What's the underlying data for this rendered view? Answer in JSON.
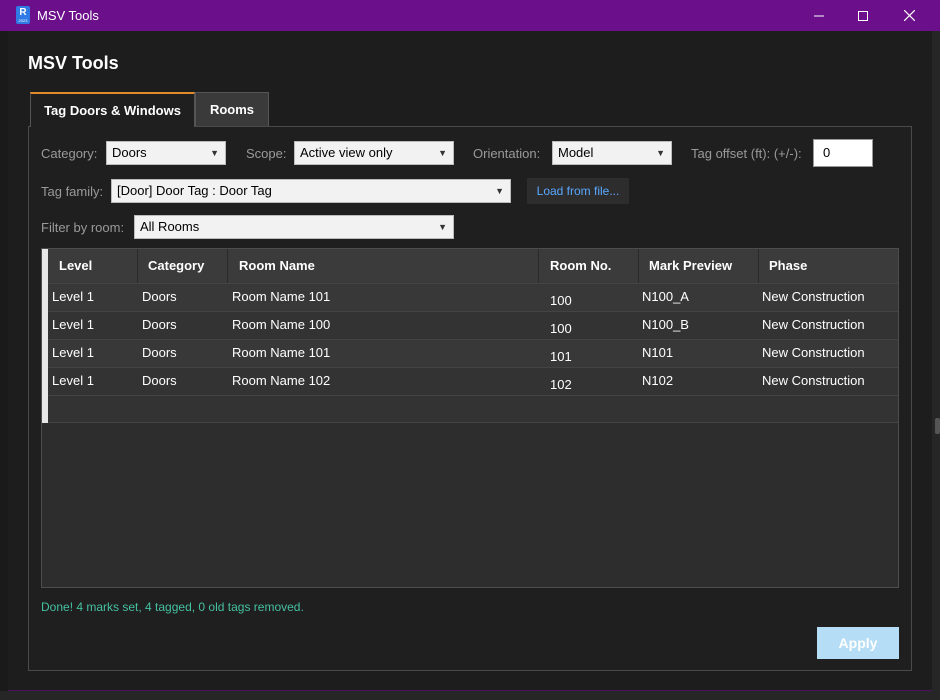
{
  "window": {
    "title": "MSV Tools",
    "icon_letter": "R",
    "icon_sub": "2023"
  },
  "page": {
    "title": "MSV Tools"
  },
  "tabs": [
    {
      "label": "Tag Doors & Windows",
      "active": true
    },
    {
      "label": "Rooms",
      "active": false
    }
  ],
  "filters": {
    "category_label": "Category:",
    "category_value": "Doors",
    "scope_label": "Scope:",
    "scope_value": "Active view only",
    "orientation_label": "Orientation:",
    "orientation_value": "Model",
    "offset_label": "Tag offset (ft): (+/-):",
    "offset_value": "0",
    "family_label": "Tag family:",
    "family_value": "[Door] Door Tag : Door Tag",
    "load_label": "Load from file...",
    "room_label": "Filter by room:",
    "room_value": "All Rooms"
  },
  "grid": {
    "columns": [
      "Level",
      "Category",
      "Room Name",
      "Room No.",
      "Mark Preview",
      "Phase"
    ],
    "rows": [
      [
        "Level 1",
        "Doors",
        "Room Name 101",
        "100",
        "N100_A",
        "New Construction"
      ],
      [
        "Level 1",
        "Doors",
        "Room Name 100",
        "100",
        "N100_B",
        "New Construction"
      ],
      [
        "Level 1",
        "Doors",
        "Room Name 101",
        "101",
        "N101",
        "New Construction"
      ],
      [
        "Level 1",
        "Doors",
        "Room Name 102",
        "102",
        "N102",
        "New Construction"
      ]
    ]
  },
  "status": "Done!  4 marks set,  4 tagged,  0 old tags removed.",
  "apply_label": "Apply",
  "colors": {
    "titlebar": "#6b0f8a",
    "active_tab_accent": "#e08a2c",
    "status": "#45c0a0",
    "link": "#5aa8ff",
    "apply": "#b5ddf5"
  }
}
